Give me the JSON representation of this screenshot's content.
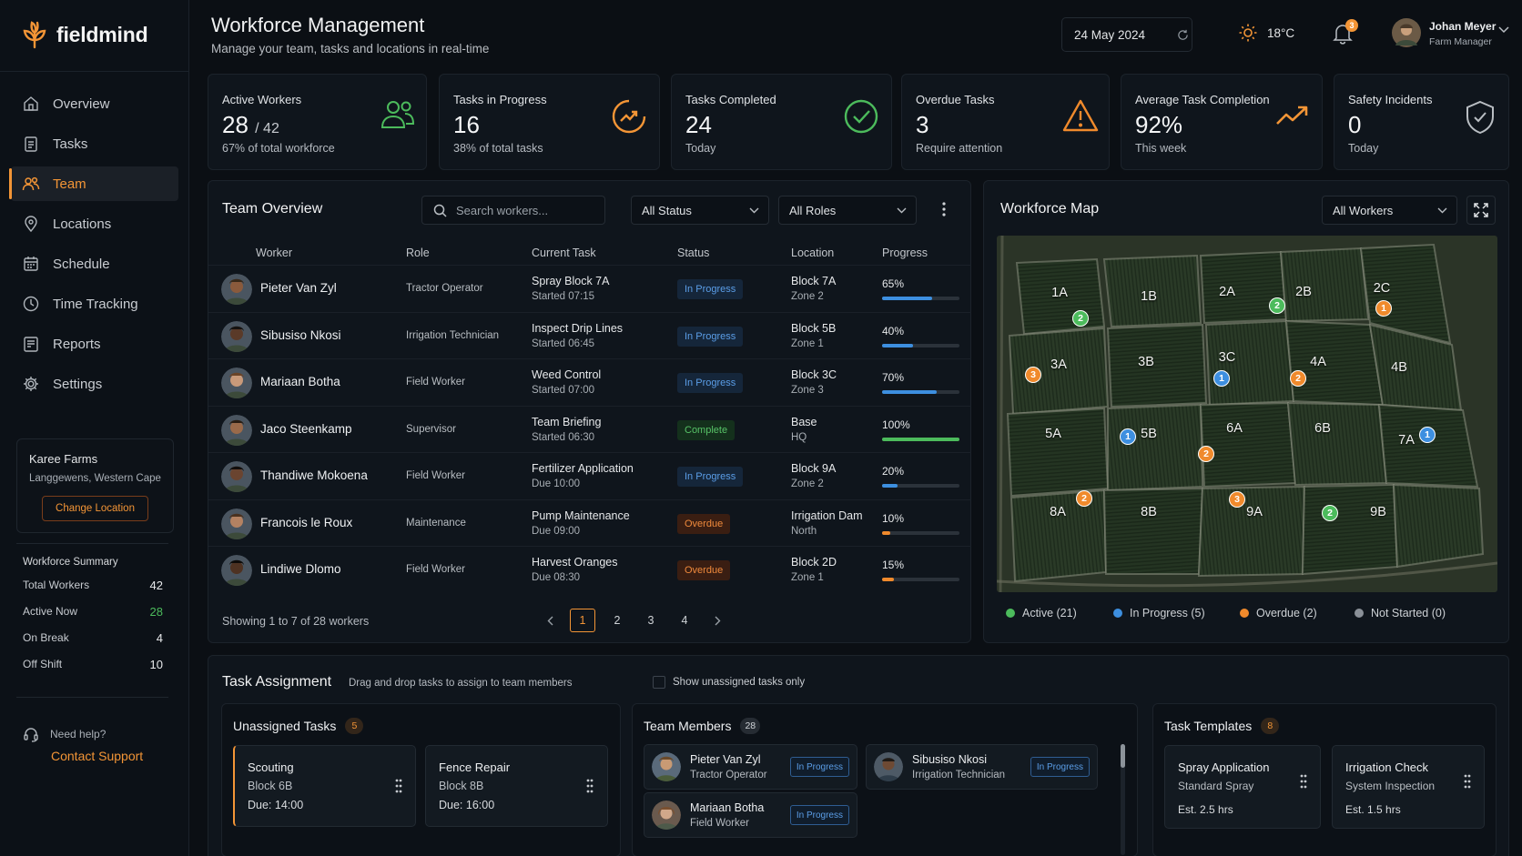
{
  "app": {
    "name": "fieldmind"
  },
  "nav": {
    "items": [
      {
        "label": "Overview",
        "icon": "overview-icon"
      },
      {
        "label": "Tasks",
        "icon": "tasks-icon"
      },
      {
        "label": "Team",
        "icon": "team-icon",
        "active": true
      },
      {
        "label": "Locations",
        "icon": "location-pin-icon"
      },
      {
        "label": "Schedule",
        "icon": "calendar-icon"
      },
      {
        "label": "Time Tracking",
        "icon": "clock-icon"
      },
      {
        "label": "Reports",
        "icon": "reports-icon"
      },
      {
        "label": "Settings",
        "icon": "gear-icon"
      }
    ]
  },
  "farm": {
    "name": "Karee Farms",
    "location": "Langgewens, Western Cape",
    "change_label": "Change Location"
  },
  "workforce_summary": {
    "title": "Workforce Summary",
    "rows": [
      {
        "label": "Total Workers",
        "value": "42"
      },
      {
        "label": "Active Now",
        "value": "28"
      },
      {
        "label": "On Break",
        "value": "4"
      },
      {
        "label": "Off Shift",
        "value": "10"
      }
    ]
  },
  "help": {
    "label": "Need help?",
    "link": "Contact Support"
  },
  "header": {
    "title": "Workforce Management",
    "subtitle": "Manage your team, tasks and locations in real-time",
    "date": "24 May 2024",
    "temperature": "18°C",
    "notification_count": "3",
    "user_name": "Johan Meyer",
    "user_role": "Farm Manager"
  },
  "stats": [
    {
      "label": "Active Workers",
      "value": "28",
      "value_suffix": "/ 42",
      "sub": "67% of total workforce"
    },
    {
      "label": "Tasks in Progress",
      "value": "16",
      "sub": "38% of total tasks"
    },
    {
      "label": "Tasks Completed",
      "value": "24",
      "sub": "Today"
    },
    {
      "label": "Overdue Tasks",
      "value": "3",
      "sub": "Require attention"
    },
    {
      "label": "Average Task Completion",
      "value": "92%",
      "sub": "This week"
    },
    {
      "label": "Safety Incidents",
      "value": "0",
      "sub": "Today"
    }
  ],
  "team_overview": {
    "title": "Team Overview",
    "search_placeholder": "Search workers...",
    "status_filter": "All Status",
    "roles_filter": "All Roles",
    "columns": [
      "Worker",
      "Role",
      "Current Task",
      "Status",
      "Location",
      "Progress"
    ],
    "rows": [
      {
        "name": "Pieter Van Zyl",
        "role": "Tractor Operator",
        "task": "Spray Block 7A",
        "task_time": "Started 07:15",
        "status": "In Progress",
        "status_type": "inprog",
        "location": "Block 7A",
        "zone": "Zone 2",
        "progress": "65%",
        "progress_value": 65
      },
      {
        "name": "Sibusiso Nkosi",
        "role": "Irrigation Technician",
        "task": "Inspect Drip Lines",
        "task_time": "Started 06:45",
        "status": "In Progress",
        "status_type": "inprog",
        "location": "Block 5B",
        "zone": "Zone 1",
        "progress": "40%",
        "progress_value": 40
      },
      {
        "name": "Mariaan Botha",
        "role": "Field Worker",
        "task": "Weed Control",
        "task_time": "Started 07:00",
        "status": "In Progress",
        "status_type": "inprog",
        "location": "Block 3C",
        "zone": "Zone 3",
        "progress": "70%",
        "progress_value": 70
      },
      {
        "name": "Jaco Steenkamp",
        "role": "Supervisor",
        "task": "Team Briefing",
        "task_time": "Started 06:30",
        "status": "Complete",
        "status_type": "complete",
        "location": "Base",
        "zone": "HQ",
        "progress": "100%",
        "progress_value": 100
      },
      {
        "name": "Thandiwe Mokoena",
        "role": "Field Worker",
        "task": "Fertilizer Application",
        "task_time": "Due 10:00",
        "status": "In Progress",
        "status_type": "inprog",
        "location": "Block 9A",
        "zone": "Zone 2",
        "progress": "20%",
        "progress_value": 20
      },
      {
        "name": "Francois le Roux",
        "role": "Maintenance",
        "task": "Pump Maintenance",
        "task_time": "Due 09:00",
        "status": "Overdue",
        "status_type": "overdue",
        "location": "Irrigation Dam",
        "zone": "North",
        "progress": "10%",
        "progress_value": 10
      },
      {
        "name": "Lindiwe Dlomo",
        "role": "Field Worker",
        "task": "Harvest Oranges",
        "task_time": "Due 08:30",
        "status": "Overdue",
        "status_type": "overdue",
        "location": "Block 2D",
        "zone": "Zone 1",
        "progress": "15%",
        "progress_value": 15
      }
    ],
    "footer": "Showing 1 to 7 of 28 workers",
    "pages": [
      "1",
      "2",
      "3",
      "4"
    ]
  },
  "workforce_map": {
    "title": "Workforce Map",
    "filter": "All Workers",
    "blocks": [
      "1A",
      "1B",
      "2A",
      "2B",
      "2C",
      "3A",
      "3B",
      "3C",
      "4A",
      "4B",
      "5A",
      "5B",
      "6A",
      "6B",
      "7A",
      "8A",
      "8B",
      "9A",
      "9B"
    ],
    "markers": [
      {
        "count": "2",
        "status": "active"
      },
      {
        "count": "2",
        "status": "active"
      },
      {
        "count": "1",
        "status": "overdue"
      },
      {
        "count": "3",
        "status": "overdue"
      },
      {
        "count": "1",
        "status": "in_progress"
      },
      {
        "count": "2",
        "status": "overdue"
      },
      {
        "count": "1",
        "status": "in_progress"
      },
      {
        "count": "2",
        "status": "overdue"
      },
      {
        "count": "1",
        "status": "in_progress"
      },
      {
        "count": "2",
        "status": "overdue"
      },
      {
        "count": "3",
        "status": "overdue"
      },
      {
        "count": "2",
        "status": "active"
      }
    ],
    "legend": [
      {
        "label": "Active (21)",
        "color": "#4cbb5c"
      },
      {
        "label": "In Progress (5)",
        "color": "#3d8fe0"
      },
      {
        "label": "Overdue (2)",
        "color": "#f08a2c"
      },
      {
        "label": "Not Started (0)",
        "color": "#8a9098"
      }
    ]
  },
  "task_assignment": {
    "title": "Task Assignment",
    "subtitle": "Drag and drop tasks to assign to team members",
    "checkbox_label": "Show unassigned tasks only",
    "unassigned": {
      "title": "Unassigned Tasks",
      "count": "5",
      "items": [
        {
          "title": "Scouting",
          "block": "Block 6B",
          "due": "Due: 14:00"
        },
        {
          "title": "Fence Repair",
          "block": "Block 8B",
          "due": "Due: 16:00"
        }
      ]
    },
    "members": {
      "title": "Team Members",
      "count": "28",
      "items": [
        {
          "name": "Pieter Van Zyl",
          "role": "Tractor Operator",
          "status": "In Progress"
        },
        {
          "name": "Sibusiso Nkosi",
          "role": "Irrigation Technician",
          "status": "In Progress"
        },
        {
          "name": "Mariaan Botha",
          "role": "Field Worker",
          "status": "In Progress"
        }
      ]
    },
    "templates": {
      "title": "Task Templates",
      "count": "8",
      "items": [
        {
          "title": "Spray Application",
          "type": "Standard Spray",
          "est": "Est. 2.5 hrs"
        },
        {
          "title": "Irrigation Check",
          "type": "System Inspection",
          "est": "Est. 1.5 hrs"
        }
      ]
    }
  },
  "colors": {
    "accent": "#f39536",
    "in_progress": "#3d8fe0",
    "complete": "#4cbb5c",
    "overdue": "#f08a2c"
  }
}
